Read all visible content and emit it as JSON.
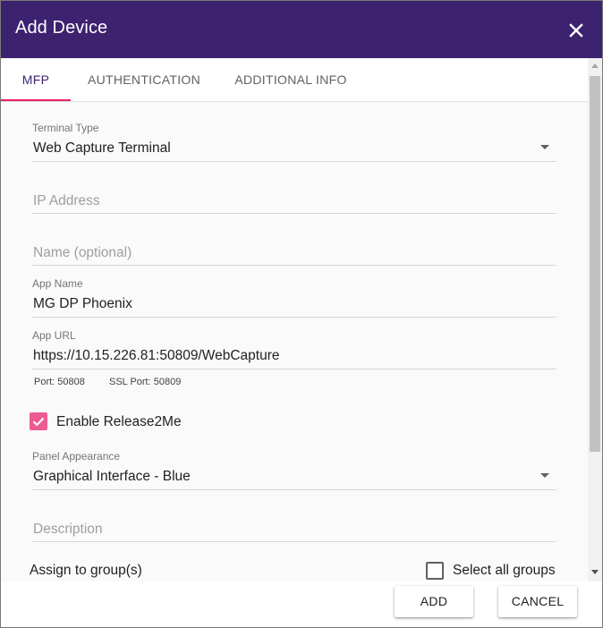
{
  "dialog": {
    "title": "Add Device",
    "close_icon": "close-icon",
    "header_color": "#3d2270",
    "accent_color": "#e91e63",
    "checkbox_color": "#ec5b92"
  },
  "tabs": [
    {
      "label": "MFP",
      "active": true
    },
    {
      "label": "AUTHENTICATION",
      "active": false
    },
    {
      "label": "ADDITIONAL INFO",
      "active": false
    }
  ],
  "form": {
    "terminal_type": {
      "label": "Terminal Type",
      "value": "Web Capture Terminal"
    },
    "ip_address": {
      "placeholder": "IP Address",
      "value": ""
    },
    "name": {
      "placeholder": "Name (optional)",
      "value": ""
    },
    "app_name": {
      "label": "App Name",
      "value": "MG DP Phoenix"
    },
    "app_url": {
      "label": "App URL",
      "value": "https://10.15.226.81:50809/WebCapture"
    },
    "port_hint": "Port: 50808",
    "ssl_port_hint": "SSL Port: 50809",
    "enable_release": {
      "label": "Enable Release2Me",
      "checked": true
    },
    "panel_appearance": {
      "label": "Panel Appearance",
      "value": "Graphical Interface - Blue"
    },
    "description": {
      "placeholder": "Description",
      "value": ""
    },
    "assign_groups_label": "Assign to group(s)",
    "select_all": {
      "label": "Select all groups",
      "checked": false
    }
  },
  "buttons": {
    "add": "ADD",
    "cancel": "CANCEL"
  }
}
